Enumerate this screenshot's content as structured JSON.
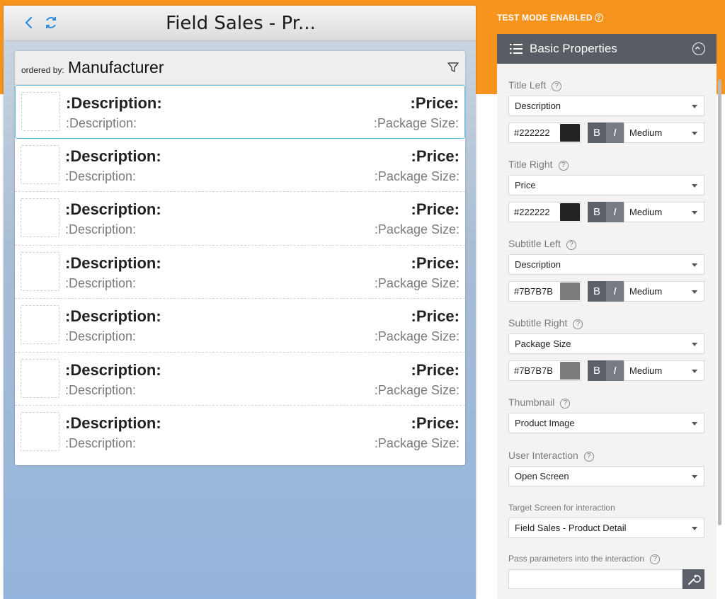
{
  "banner": {
    "test_mode": "TEST MODE ENABLED"
  },
  "preview": {
    "title": "Field Sales - Pr...",
    "ordered_by_label": "ordered by:",
    "ordered_by_value": "Manufacturer",
    "rows": [
      {
        "title_left": ":Description:",
        "title_right": ":Price:",
        "subtitle_left": ":Description:",
        "subtitle_right": ":Package Size:"
      },
      {
        "title_left": ":Description:",
        "title_right": ":Price:",
        "subtitle_left": ":Description:",
        "subtitle_right": ":Package Size:"
      },
      {
        "title_left": ":Description:",
        "title_right": ":Price:",
        "subtitle_left": ":Description:",
        "subtitle_right": ":Package Size:"
      },
      {
        "title_left": ":Description:",
        "title_right": ":Price:",
        "subtitle_left": ":Description:",
        "subtitle_right": ":Package Size:"
      },
      {
        "title_left": ":Description:",
        "title_right": ":Price:",
        "subtitle_left": ":Description:",
        "subtitle_right": ":Package Size:"
      },
      {
        "title_left": ":Description:",
        "title_right": ":Price:",
        "subtitle_left": ":Description:",
        "subtitle_right": ":Package Size:"
      },
      {
        "title_left": ":Description:",
        "title_right": ":Price:",
        "subtitle_left": ":Description:",
        "subtitle_right": ":Package Size:"
      }
    ]
  },
  "panel": {
    "title": "Basic Properties",
    "title_left": {
      "label": "Title Left",
      "value": "Description",
      "color": "#222222",
      "bold": "B",
      "italic": "I",
      "size": "Medium"
    },
    "title_right": {
      "label": "Title Right",
      "value": "Price",
      "color": "#222222",
      "bold": "B",
      "italic": "I",
      "size": "Medium"
    },
    "subtitle_left": {
      "label": "Subtitle Left",
      "value": "Description",
      "color": "#7B7B7B",
      "bold": "B",
      "italic": "I",
      "size": "Medium"
    },
    "subtitle_right": {
      "label": "Subtitle Right",
      "value": "Package Size",
      "color": "#7B7B7B",
      "bold": "B",
      "italic": "I",
      "size": "Medium"
    },
    "thumbnail": {
      "label": "Thumbnail",
      "value": "Product Image"
    },
    "user_interaction": {
      "label": "User Interaction",
      "value": "Open Screen"
    },
    "target_screen": {
      "label": "Target Screen for interaction",
      "value": "Field Sales - Product Detail"
    },
    "pass_params": {
      "label": "Pass parameters into the interaction",
      "value": ""
    }
  },
  "colors": {
    "accent": "#f7941d",
    "panel_header": "#585c63",
    "selection": "#5bc0de",
    "dark_text": "#222222",
    "gray_text": "#7B7B7B"
  },
  "icons": [
    "back-icon",
    "refresh-icon",
    "filter-icon",
    "list-icon",
    "collapse-icon",
    "help-icon",
    "caret-down-icon",
    "wrench-icon"
  ]
}
